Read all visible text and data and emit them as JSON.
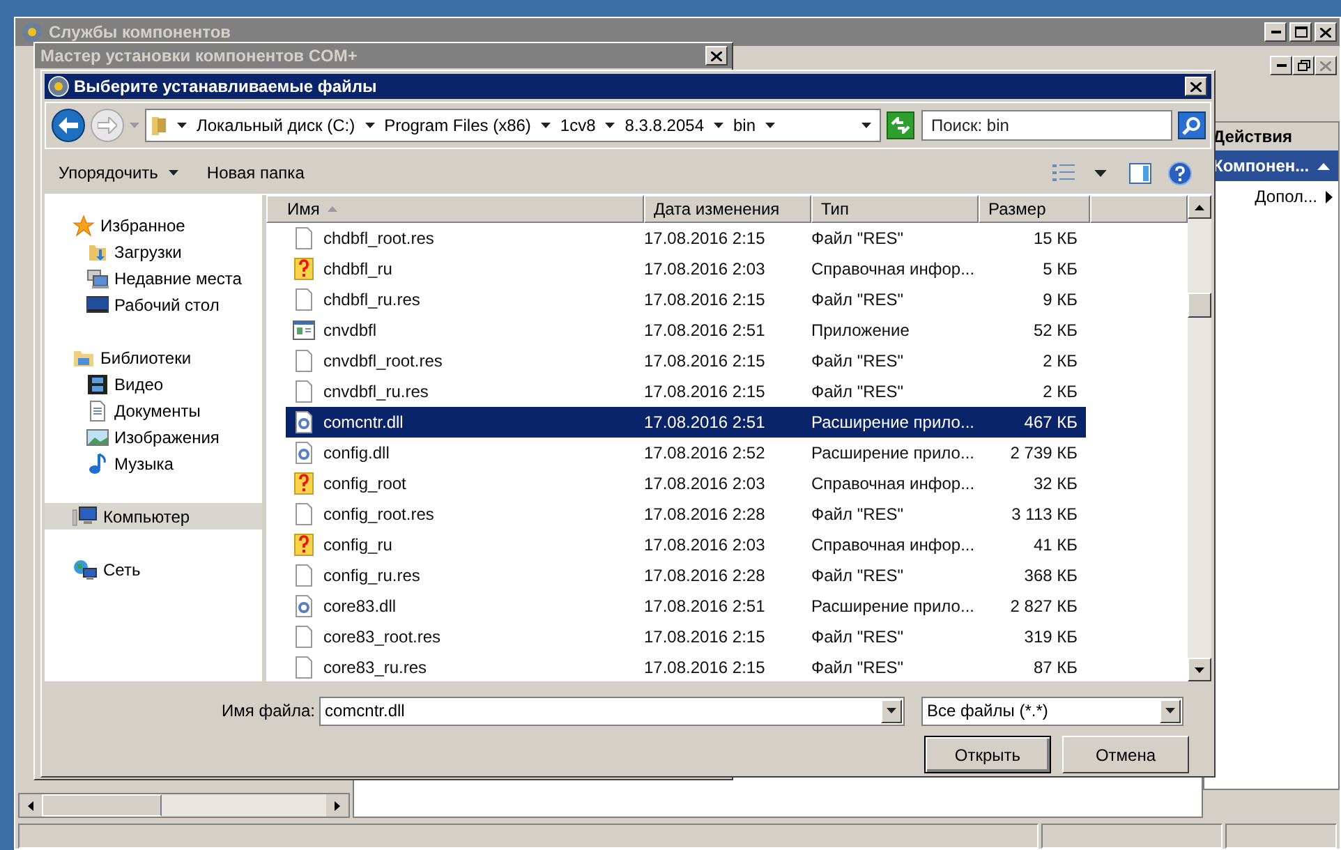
{
  "background_window": {
    "title": "Службы компонентов",
    "actions_panel": {
      "title": "Действия",
      "section": "Компонен...",
      "item": "Допол..."
    }
  },
  "wizard_window": {
    "title": "Мастер установки компонентов COM+"
  },
  "dialog": {
    "title": "Выберите устанавливаемые файлы",
    "breadcrumbs": [
      "Локальный диск (C:)",
      "Program Files (x86)",
      "1cv8",
      "8.3.8.2054",
      "bin"
    ],
    "search": {
      "placeholder": "Поиск: bin"
    },
    "toolbar": {
      "organize": "Упорядочить",
      "new_folder": "Новая папка"
    },
    "nav": [
      {
        "label": "Избранное",
        "kind": "star",
        "selected": false,
        "children": [
          {
            "label": "Загрузки",
            "kind": "downloads",
            "selected": false
          },
          {
            "label": "Недавние места",
            "kind": "recent",
            "selected": false
          },
          {
            "label": "Рабочий стол",
            "kind": "desktop",
            "selected": false
          }
        ]
      },
      {
        "label": "Библиотеки",
        "kind": "library",
        "selected": false,
        "children": [
          {
            "label": "Видео",
            "kind": "video",
            "selected": false
          },
          {
            "label": "Документы",
            "kind": "documents",
            "selected": false
          },
          {
            "label": "Изображения",
            "kind": "pictures",
            "selected": false
          },
          {
            "label": "Музыка",
            "kind": "music",
            "selected": false
          }
        ]
      },
      {
        "label": "Компьютер",
        "kind": "computer",
        "selected": true
      },
      {
        "label": "Сеть",
        "kind": "network",
        "selected": false
      }
    ],
    "columns": [
      {
        "label": "Имя",
        "sorted": true
      },
      {
        "label": "Дата изменения",
        "sorted": false
      },
      {
        "label": "Тип",
        "sorted": false
      },
      {
        "label": "Размер",
        "sorted": false
      }
    ],
    "rows": [
      {
        "name": "chdbfl_root.res",
        "date": "17.08.2016 2:15",
        "type": "Файл \"RES\"",
        "size": "15 КБ",
        "kind": "res",
        "selected": false
      },
      {
        "name": "chdbfl_ru",
        "date": "17.08.2016 2:03",
        "type": "Справочная инфор...",
        "size": "5 КБ",
        "kind": "help",
        "selected": false
      },
      {
        "name": "chdbfl_ru.res",
        "date": "17.08.2016 2:15",
        "type": "Файл \"RES\"",
        "size": "9 КБ",
        "kind": "res",
        "selected": false
      },
      {
        "name": "cnvdbfl",
        "date": "17.08.2016 2:51",
        "type": "Приложение",
        "size": "52 КБ",
        "kind": "app",
        "selected": false
      },
      {
        "name": "cnvdbfl_root.res",
        "date": "17.08.2016 2:15",
        "type": "Файл \"RES\"",
        "size": "2 КБ",
        "kind": "res",
        "selected": false
      },
      {
        "name": "cnvdbfl_ru.res",
        "date": "17.08.2016 2:15",
        "type": "Файл \"RES\"",
        "size": "2 КБ",
        "kind": "res",
        "selected": false
      },
      {
        "name": "comcntr.dll",
        "date": "17.08.2016 2:51",
        "type": "Расширение прило...",
        "size": "467 КБ",
        "kind": "dll",
        "selected": true
      },
      {
        "name": "config.dll",
        "date": "17.08.2016 2:52",
        "type": "Расширение прило...",
        "size": "2 739 КБ",
        "kind": "dll",
        "selected": false
      },
      {
        "name": "config_root",
        "date": "17.08.2016 2:03",
        "type": "Справочная инфор...",
        "size": "32 КБ",
        "kind": "help",
        "selected": false
      },
      {
        "name": "config_root.res",
        "date": "17.08.2016 2:28",
        "type": "Файл \"RES\"",
        "size": "3 113 КБ",
        "kind": "res",
        "selected": false
      },
      {
        "name": "config_ru",
        "date": "17.08.2016 2:03",
        "type": "Справочная инфор...",
        "size": "41 КБ",
        "kind": "help",
        "selected": false
      },
      {
        "name": "config_ru.res",
        "date": "17.08.2016 2:28",
        "type": "Файл \"RES\"",
        "size": "368 КБ",
        "kind": "res",
        "selected": false
      },
      {
        "name": "core83.dll",
        "date": "17.08.2016 2:51",
        "type": "Расширение прило...",
        "size": "2 827 КБ",
        "kind": "dll",
        "selected": false
      },
      {
        "name": "core83_root.res",
        "date": "17.08.2016 2:15",
        "type": "Файл \"RES\"",
        "size": "319 КБ",
        "kind": "res",
        "selected": false
      },
      {
        "name": "core83_ru.res",
        "date": "17.08.2016 2:15",
        "type": "Файл \"RES\"",
        "size": "87 КБ",
        "kind": "res",
        "selected": false
      }
    ],
    "file_name_label": "Имя файла:",
    "file_name": "comcntr.dll",
    "file_type": "Все файлы (*.*)",
    "buttons": [
      {
        "label": "Открыть",
        "default": true
      },
      {
        "label": "Отмена",
        "default": false
      }
    ]
  }
}
